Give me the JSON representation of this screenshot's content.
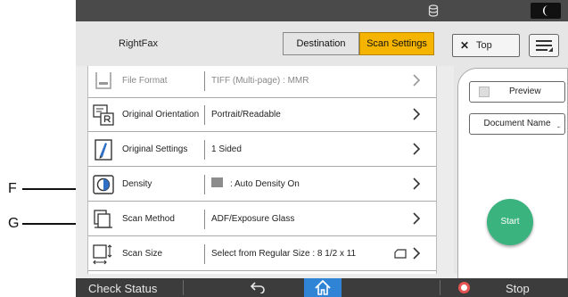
{
  "header": {
    "app_title": "RightFax",
    "tabs": [
      {
        "label": "Destination",
        "active": false
      },
      {
        "label": "Scan Settings",
        "active": true
      }
    ],
    "top_button": "Top",
    "menu_icon": "menu-icon",
    "status_icons": [
      "database-icon",
      "moon-icon"
    ]
  },
  "settings": [
    {
      "label": "File Format",
      "value": "TIFF (Multi-page) : MMR",
      "icon": "file-format-icon"
    },
    {
      "label": "Original Orientation",
      "value": "Portrait/Readable",
      "icon": "orientation-icon"
    },
    {
      "label": "Original Settings",
      "value": "1 Sided",
      "icon": "original-settings-icon"
    },
    {
      "label": "Density",
      "value": ": Auto Density On",
      "icon": "density-icon"
    },
    {
      "label": "Scan Method",
      "value": "ADF/Exposure Glass",
      "icon": "scan-method-icon"
    },
    {
      "label": "Scan Size",
      "value": "Select from Regular Size : 8 1/2 x 11",
      "icon": "scan-size-icon"
    }
  ],
  "side": {
    "preview_label": "Preview",
    "preview_checked": false,
    "document_name_label": "Document Name",
    "document_name_dots": "...",
    "start_label": "Start"
  },
  "bottom": {
    "check_status": "Check Status",
    "stop": "Stop"
  },
  "callouts": [
    "F",
    "G"
  ],
  "colors": {
    "active_tab": "#f5b400",
    "start": "#3ab37e",
    "home": "#2f84d6",
    "stop": "#e65353",
    "bars": "#3c3c3c"
  }
}
